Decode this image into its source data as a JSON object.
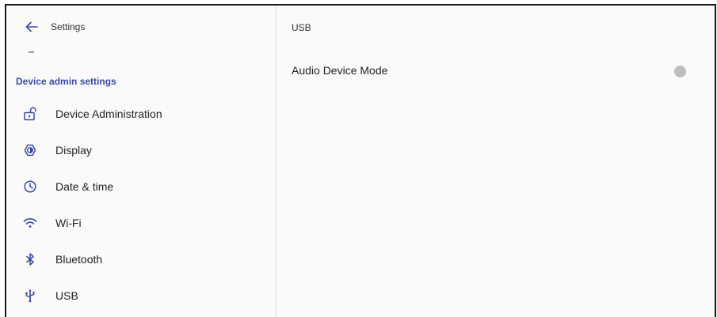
{
  "topbar": {
    "back_icon": "arrow-back-icon",
    "title": "Settings"
  },
  "sidebar": {
    "section_header": "Device admin settings",
    "items": [
      {
        "label": "Device Administration",
        "icon": "lock-open-icon"
      },
      {
        "label": "Display",
        "icon": "brightness-icon"
      },
      {
        "label": "Date & time",
        "icon": "clock-icon"
      },
      {
        "label": "Wi-Fi",
        "icon": "wifi-icon"
      },
      {
        "label": "Bluetooth",
        "icon": "bluetooth-icon"
      },
      {
        "label": "USB",
        "icon": "usb-icon"
      }
    ]
  },
  "main": {
    "title": "USB",
    "preferences": [
      {
        "label": "Audio Device Mode",
        "control": "switch",
        "checked": false
      }
    ]
  },
  "colors": {
    "section_header": "#3a4aa6",
    "icon": "#3a4aa6",
    "switch_thumb_off": "#bdbdbd",
    "background": "#fafafa"
  }
}
